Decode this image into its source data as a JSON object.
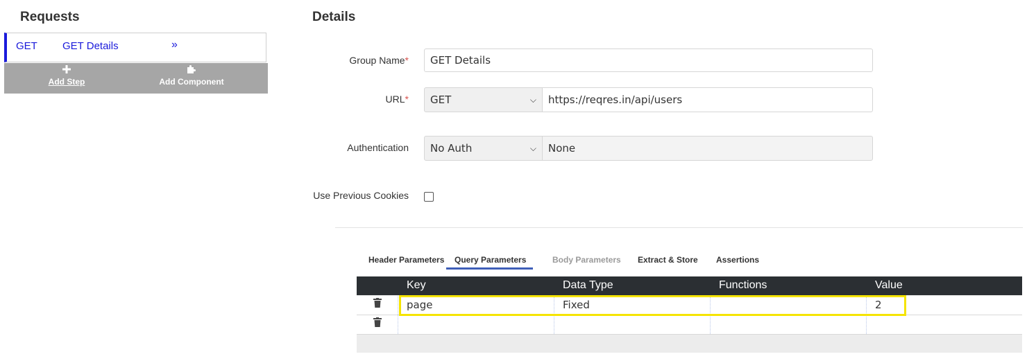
{
  "left": {
    "title": "Requests",
    "request": {
      "method": "GET",
      "name": "GET Details",
      "chevron": "»"
    },
    "toolbar": {
      "add_step_label": "Add Step",
      "add_step_icon": "plus-icon",
      "add_component_label": "Add Component",
      "add_component_icon": "puzzle-icon"
    }
  },
  "details": {
    "title": "Details",
    "group_name": {
      "label": "Group Name",
      "required": "*",
      "value": "GET Details"
    },
    "url": {
      "label": "URL",
      "required": "*",
      "method": "GET",
      "value": "https://reqres.in/api/users"
    },
    "authentication": {
      "label": "Authentication",
      "type": "No Auth",
      "value": "None"
    },
    "use_previous_cookies": {
      "label": "Use Previous Cookies",
      "checked": false
    }
  },
  "tabs": [
    {
      "label": "Header Parameters",
      "state": "normal"
    },
    {
      "label": "Query Parameters",
      "state": "active"
    },
    {
      "label": "Body Parameters",
      "state": "disabled"
    },
    {
      "label": "Extract & Store",
      "state": "normal"
    },
    {
      "label": "Assertions",
      "state": "normal"
    }
  ],
  "table": {
    "headers": [
      "Key",
      "Data Type",
      "Functions",
      "Value"
    ],
    "rows": [
      {
        "key": "page",
        "data_type": "Fixed",
        "functions": "",
        "value": "2"
      },
      {
        "key": "",
        "data_type": "",
        "functions": "",
        "value": ""
      }
    ]
  },
  "colors": {
    "accent": "#1a1adb",
    "table_header": "#2b2f33",
    "highlight": "#f5e400",
    "tab_active": "#3e5eb8"
  }
}
